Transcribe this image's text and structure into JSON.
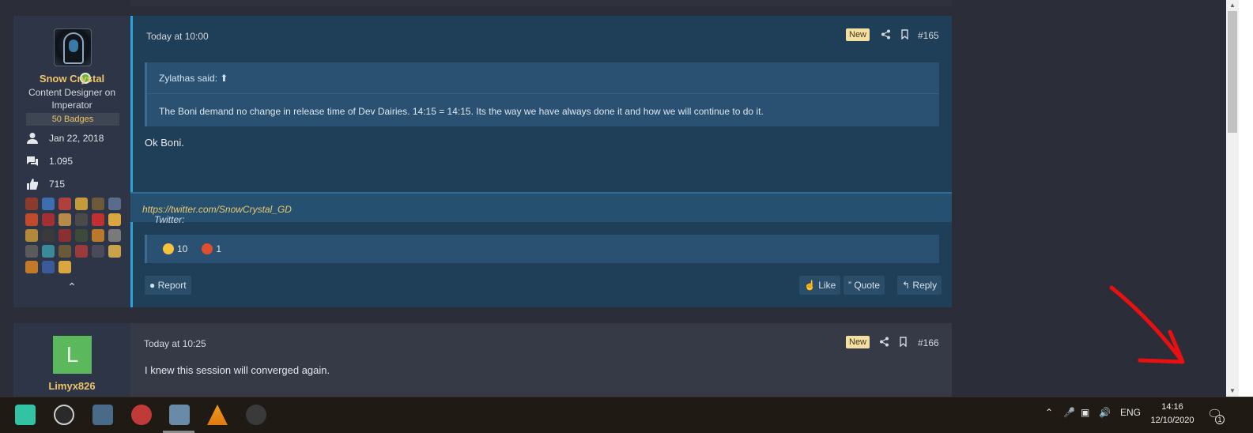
{
  "user1": {
    "name": "Snow Crystal",
    "title": "Content Designer on Imperator",
    "badges": "50 Badges",
    "joined": "Jan 22, 2018",
    "messages": "1.095",
    "reactions": "715",
    "collapse_icon": "chevron-up-icon"
  },
  "post1": {
    "time": "Today at 10:00",
    "new_label": "New",
    "number": "#165",
    "quote_author": "Zylathas said:",
    "quote_text": "The Boni demand no change in release time of Dev Dairies. 14:15 = 14:15. Its the way we have always done it and how we will continue to do it.",
    "body": "Ok Boni.",
    "signature_prefix": "Twitter: ",
    "signature_link": "https://twitter.com/SnowCrystal_GD",
    "reactions": [
      {
        "icon": "laughing-emoji-icon",
        "count": "10",
        "color": "#f5c33b"
      },
      {
        "icon": "angry-emoji-icon",
        "count": "1",
        "color": "#e04e2c"
      }
    ],
    "report_label": "Report",
    "like_label": "Like",
    "quote_label": "Quote",
    "reply_label": "Reply"
  },
  "user2": {
    "name": "Limyx826",
    "avatar_letter": "L",
    "avatar_color": "#5cb85c"
  },
  "post2": {
    "time": "Today at 10:25",
    "new_label": "New",
    "number": "#166",
    "body": "I knew this session will converged again."
  },
  "taskbar": {
    "apps": [
      "streamlabs-icon",
      "obs-icon",
      "calculator-icon",
      "paint-icon",
      "photos-icon",
      "vlc-icon",
      "davinci-resolve-icon"
    ],
    "language": "ENG",
    "time": "14:16",
    "date": "12/10/2020",
    "notification_count": "1"
  },
  "colors": {
    "accent": "#29a3d9",
    "username": "#eec46a",
    "new_badge": "#f3dfa1",
    "drawn_arrow": "#e81010"
  }
}
